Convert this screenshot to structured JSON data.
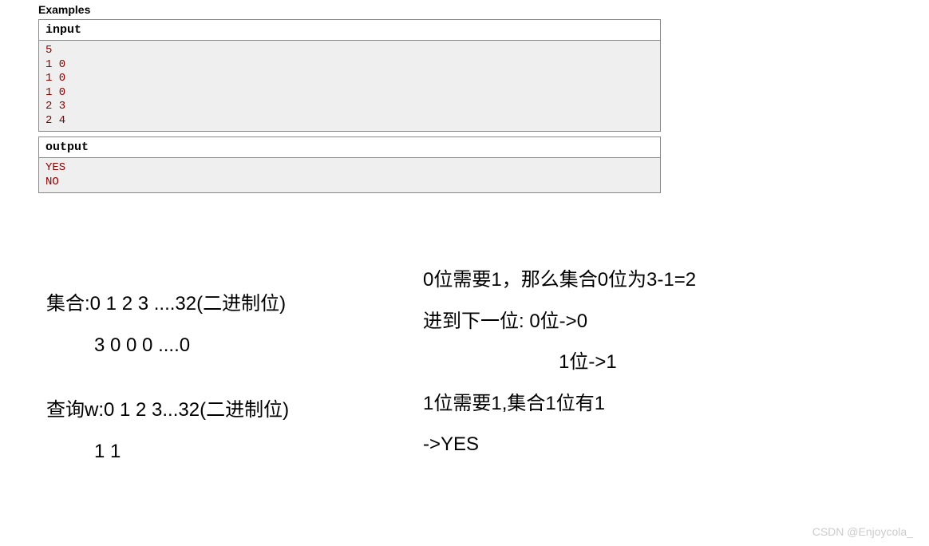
{
  "examples": {
    "title": "Examples",
    "input_label": "input",
    "input_text": "5\n1 0\n1 0\n1 0\n2 3\n2 4",
    "output_label": "output",
    "output_text": "YES\nNO"
  },
  "notes": {
    "left": {
      "line1": "集合:0 1 2 3 ....32(二进制位)",
      "line2": "3 0 0 0 ....0",
      "line3": "查询w:0 1 2 3...32(二进制位)",
      "line4": "1  1"
    },
    "right": {
      "line1": "0位需要1，那么集合0位为3-1=2",
      "line2": "进到下一位: 0位->0",
      "line3": "1位->1",
      "line4": "1位需要1,集合1位有1",
      "line5": "->YES"
    }
  },
  "watermark": "CSDN @Enjoycola_"
}
